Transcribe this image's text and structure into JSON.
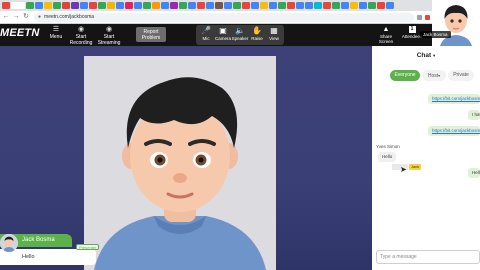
{
  "browser": {
    "url": "meetn.com/jackbosma",
    "tab_colors": [
      "#e8453c",
      "#4285f4",
      "#34a853",
      "#4285f4",
      "#fbbc05",
      "#34a853",
      "#db4437",
      "#673ab7",
      "#4285f4",
      "#e8453c",
      "#34a853",
      "#f4b400",
      "#4285f4",
      "#e91e63",
      "#4285f4",
      "#34a853",
      "#ff9800",
      "#4285f4",
      "#9c27b0",
      "#34a853",
      "#4285f4",
      "#e8453c",
      "#4285f4",
      "#795548",
      "#4285f4",
      "#34a853",
      "#e8453c",
      "#4285f4",
      "#fbbc05",
      "#4285f4",
      "#34a853",
      "#e8453c",
      "#4285f4",
      "#4285f4",
      "#00bcd4",
      "#e8453c",
      "#34a853",
      "#4285f4",
      "#fbbc05",
      "#4285f4",
      "#34a853",
      "#e8453c",
      "#4285f4"
    ]
  },
  "header": {
    "logo": "MEETN",
    "menu_label": "Menu",
    "start_recording": "Start Recording",
    "start_streaming": "Start Streaming",
    "report_problem": "Report Problem",
    "controls": [
      {
        "label": "Mic",
        "icon": "microphone-icon"
      },
      {
        "label": "Camera",
        "icon": "camera-icon"
      },
      {
        "label": "Speaker",
        "icon": "speaker-icon"
      },
      {
        "label": "Raise",
        "icon": "raise-hand-icon"
      },
      {
        "label": "View",
        "icon": "view-icon"
      }
    ],
    "share_screen": "Share Screen",
    "attendees_count": "1",
    "attendees_label": "Attendees"
  },
  "user_overlay": {
    "name": "Jack Bosma"
  },
  "self_card": {
    "name": "Jack Bosma",
    "tag": "Presenter",
    "message": "Hello"
  },
  "chat": {
    "title": "Chat",
    "tabs": [
      "Everyone",
      "Host",
      "Private"
    ],
    "messages": [
      {
        "type": "out",
        "text": "https://bit.com/jackbosma"
      },
      {
        "type": "out-plain",
        "text": "I have"
      },
      {
        "type": "out",
        "text": "https://bit.com/jackbosma"
      },
      {
        "type": "sender",
        "text": "Yves Simon"
      },
      {
        "type": "in",
        "text": "Hello"
      },
      {
        "type": "out-plain",
        "text": "Hello"
      }
    ],
    "highlight_text": "Jack",
    "input_placeholder": "Type a message"
  },
  "colors": {
    "accent_green": "#5db14a",
    "header_bg": "#141414",
    "stage_bg": "#3d4178"
  }
}
